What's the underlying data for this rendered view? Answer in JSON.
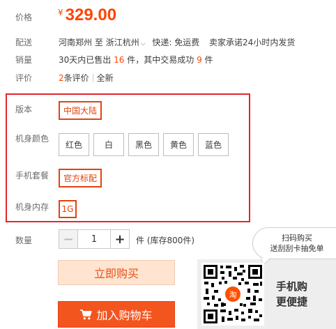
{
  "price": {
    "label": "价格",
    "currency": "¥",
    "value": "329.00"
  },
  "delivery": {
    "label": "配送",
    "from": "河南郑州",
    "to_word": "至",
    "to": "浙江杭州",
    "shipping": "快递: 免运费",
    "promise": "卖家承诺24小时内发货"
  },
  "sales": {
    "label": "销量",
    "prefix": "30天内已售出",
    "sold": "16",
    "mid": "件，其中交易成功",
    "success": "9",
    "suffix": "件"
  },
  "reviews": {
    "label": "评价",
    "count": "2",
    "unit": "条评价",
    "link": "全新"
  },
  "sku": {
    "version": {
      "label": "版本",
      "selected": "中国大陆"
    },
    "color": {
      "label": "机身颜色",
      "options": [
        "红色",
        "白",
        "黑色",
        "黄色",
        "蓝色"
      ]
    },
    "package": {
      "label": "手机套餐",
      "selected": "官方标配"
    },
    "memory": {
      "label": "机身内存",
      "selected": "1G"
    }
  },
  "quantity": {
    "label": "数量",
    "minus": "−",
    "plus": "+",
    "value": "1",
    "stock_text": "件 (库存800件)"
  },
  "actions": {
    "buy_now": "立即购买",
    "add_to_cart": "加入购物车"
  },
  "qr": {
    "bubble_line1": "扫码购买",
    "bubble_line2": "送刮刮卡抽免单",
    "mobile_line1": "手机购",
    "mobile_line2": "更便捷",
    "logo_char": "淘"
  },
  "colors": {
    "accent": "#ff4400",
    "highlight_box": "#e3262b",
    "cart_bg": "#f3551f",
    "buy_bg": "#ffe4d0"
  }
}
